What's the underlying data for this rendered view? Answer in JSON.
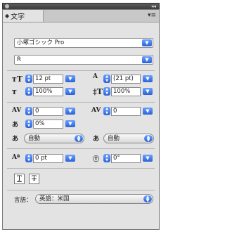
{
  "panel": {
    "tab_label": "文字",
    "font_family": "小塚ゴシック Pro",
    "font_style": "R",
    "font_size": "12 pt",
    "leading": "(21 pt)",
    "vertical_scale": "100%",
    "horizontal_scale": "100%",
    "kerning": "0",
    "tracking": "0",
    "tsume": "0%",
    "aki_left": "自動",
    "aki_right": "自動",
    "baseline_shift": "0 pt",
    "rotation": "0°",
    "language_label": "言語：",
    "language_value": "英語：米国"
  }
}
